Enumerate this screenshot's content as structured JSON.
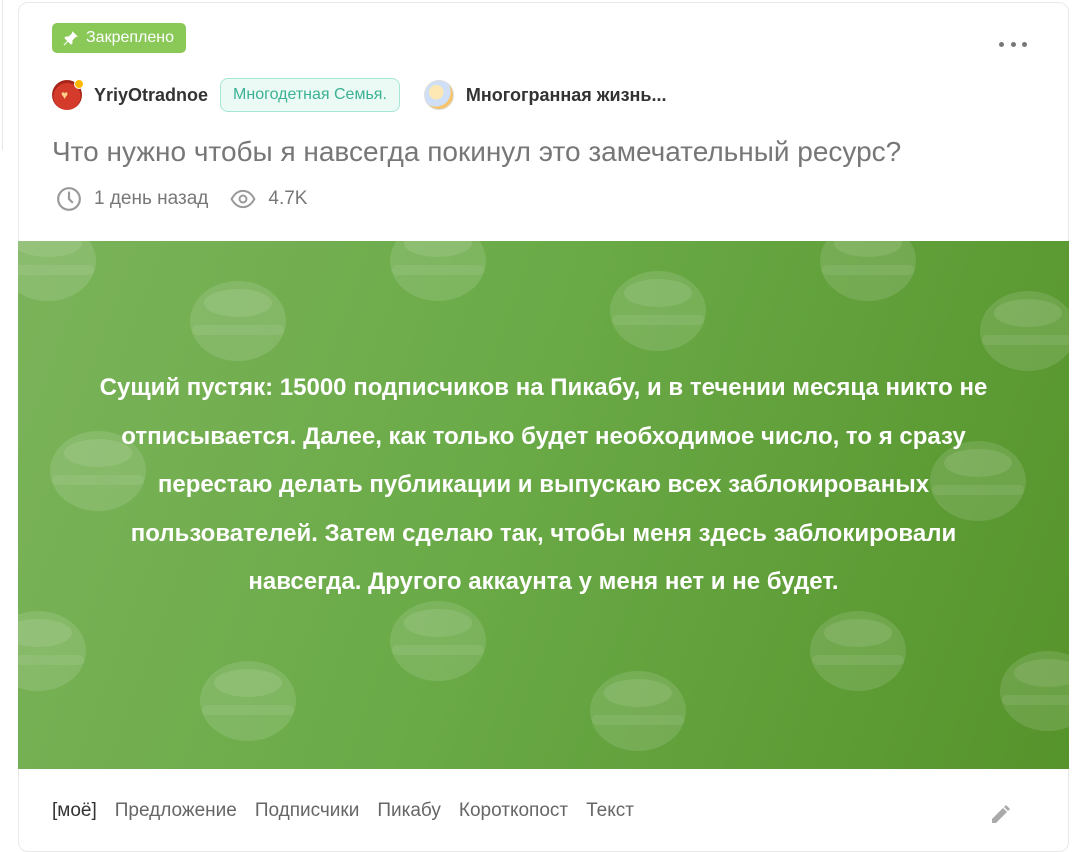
{
  "badge": {
    "label": "Закреплено",
    "color": "#8ac858"
  },
  "post": {
    "author": "YriyOtradnoe",
    "author_tag": "Многодетная Семья.",
    "community": "Многогранная жизнь...",
    "title": "Что нужно чтобы я навсегда покинул это замечательный ресурс?",
    "time": "1 день назад",
    "views": "4.7K",
    "image_text": "Сущий пустяк: 15000 подписчиков на Пикабу, и в течении месяца никто не отписывается. Далее, как только будет необходимое число, то я сразу перестаю делать публикации и выпускаю всех заблокированых пользователей. Затем сделаю так, чтобы меня здесь заблокировали навсегда. Другого аккаунта у меня нет и не будет."
  },
  "tags": [
    "[моё]",
    "Предложение",
    "Подписчики",
    "Пикабу",
    "Короткопост",
    "Текст"
  ],
  "icons": {
    "pin": "pin-icon",
    "more": "more-dots-icon",
    "clock": "clock-icon",
    "eye": "eye-icon",
    "edit": "pencil-icon"
  }
}
